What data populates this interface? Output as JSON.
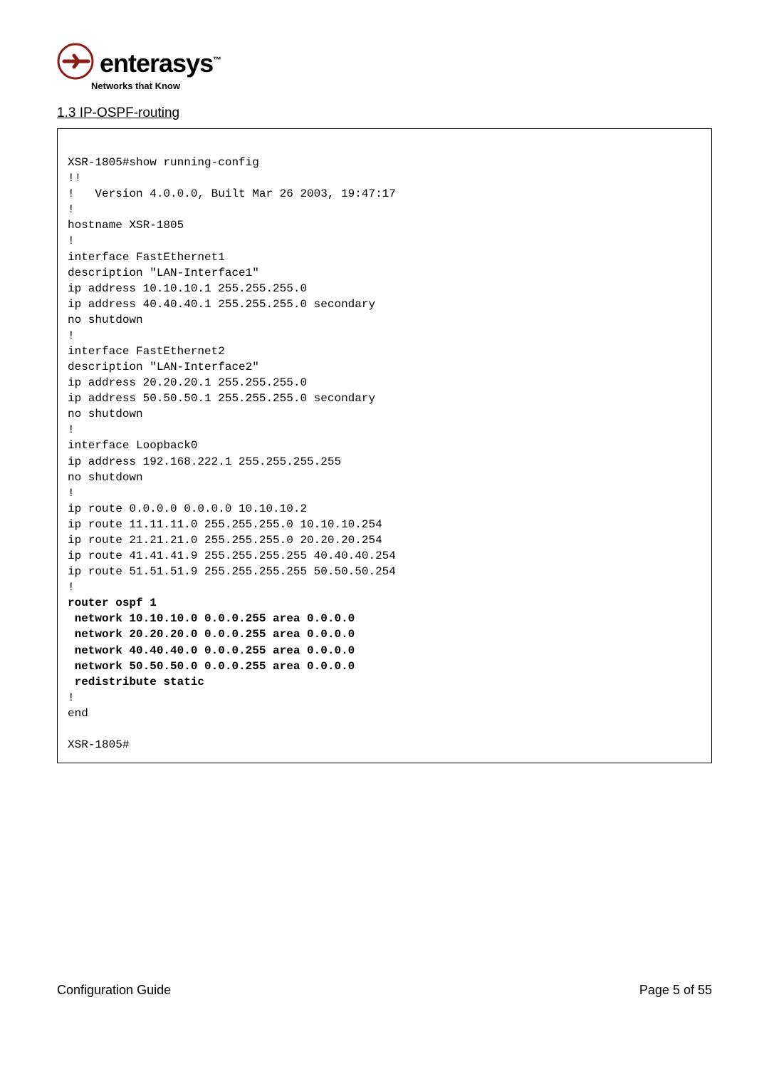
{
  "logo": {
    "name": "enterasys",
    "tm": "™",
    "tagline": "Networks that Know"
  },
  "section": {
    "heading": "1.3 IP-OSPF-routing"
  },
  "code": {
    "lines": [
      {
        "t": "",
        "b": false
      },
      {
        "t": "XSR-1805#show running-config",
        "b": false
      },
      {
        "t": "!!",
        "b": false
      },
      {
        "t": "!   Version 4.0.0.0, Built Mar 26 2003, 19:47:17",
        "b": false
      },
      {
        "t": "!",
        "b": false
      },
      {
        "t": "hostname XSR-1805",
        "b": false
      },
      {
        "t": "!",
        "b": false
      },
      {
        "t": "interface FastEthernet1",
        "b": false
      },
      {
        "t": "description \"LAN-Interface1\"",
        "b": false
      },
      {
        "t": "ip address 10.10.10.1 255.255.255.0",
        "b": false
      },
      {
        "t": "ip address 40.40.40.1 255.255.255.0 secondary",
        "b": false
      },
      {
        "t": "no shutdown",
        "b": false
      },
      {
        "t": "!",
        "b": false
      },
      {
        "t": "interface FastEthernet2",
        "b": false
      },
      {
        "t": "description \"LAN-Interface2\"",
        "b": false
      },
      {
        "t": "ip address 20.20.20.1 255.255.255.0",
        "b": false
      },
      {
        "t": "ip address 50.50.50.1 255.255.255.0 secondary",
        "b": false
      },
      {
        "t": "no shutdown",
        "b": false
      },
      {
        "t": "!",
        "b": false
      },
      {
        "t": "interface Loopback0",
        "b": false
      },
      {
        "t": "ip address 192.168.222.1 255.255.255.255",
        "b": false
      },
      {
        "t": "no shutdown",
        "b": false
      },
      {
        "t": "!",
        "b": false
      },
      {
        "t": "ip route 0.0.0.0 0.0.0.0 10.10.10.2",
        "b": false
      },
      {
        "t": "ip route 11.11.11.0 255.255.255.0 10.10.10.254",
        "b": false
      },
      {
        "t": "ip route 21.21.21.0 255.255.255.0 20.20.20.254",
        "b": false
      },
      {
        "t": "ip route 41.41.41.9 255.255.255.255 40.40.40.254",
        "b": false
      },
      {
        "t": "ip route 51.51.51.9 255.255.255.255 50.50.50.254",
        "b": false
      },
      {
        "t": "!",
        "b": false
      },
      {
        "t": "router ospf 1",
        "b": true
      },
      {
        "t": " network 10.10.10.0 0.0.0.255 area 0.0.0.0",
        "b": true
      },
      {
        "t": " network 20.20.20.0 0.0.0.255 area 0.0.0.0",
        "b": true
      },
      {
        "t": " network 40.40.40.0 0.0.0.255 area 0.0.0.0",
        "b": true
      },
      {
        "t": " network 50.50.50.0 0.0.0.255 area 0.0.0.0",
        "b": true
      },
      {
        "t": " redistribute static",
        "b": true
      },
      {
        "t": "!",
        "b": false
      },
      {
        "t": "end",
        "b": false
      },
      {
        "t": "",
        "b": false
      },
      {
        "t": "XSR-1805#",
        "b": false
      }
    ]
  },
  "footer": {
    "left": "Configuration Guide",
    "right": "Page 5 of 55"
  }
}
